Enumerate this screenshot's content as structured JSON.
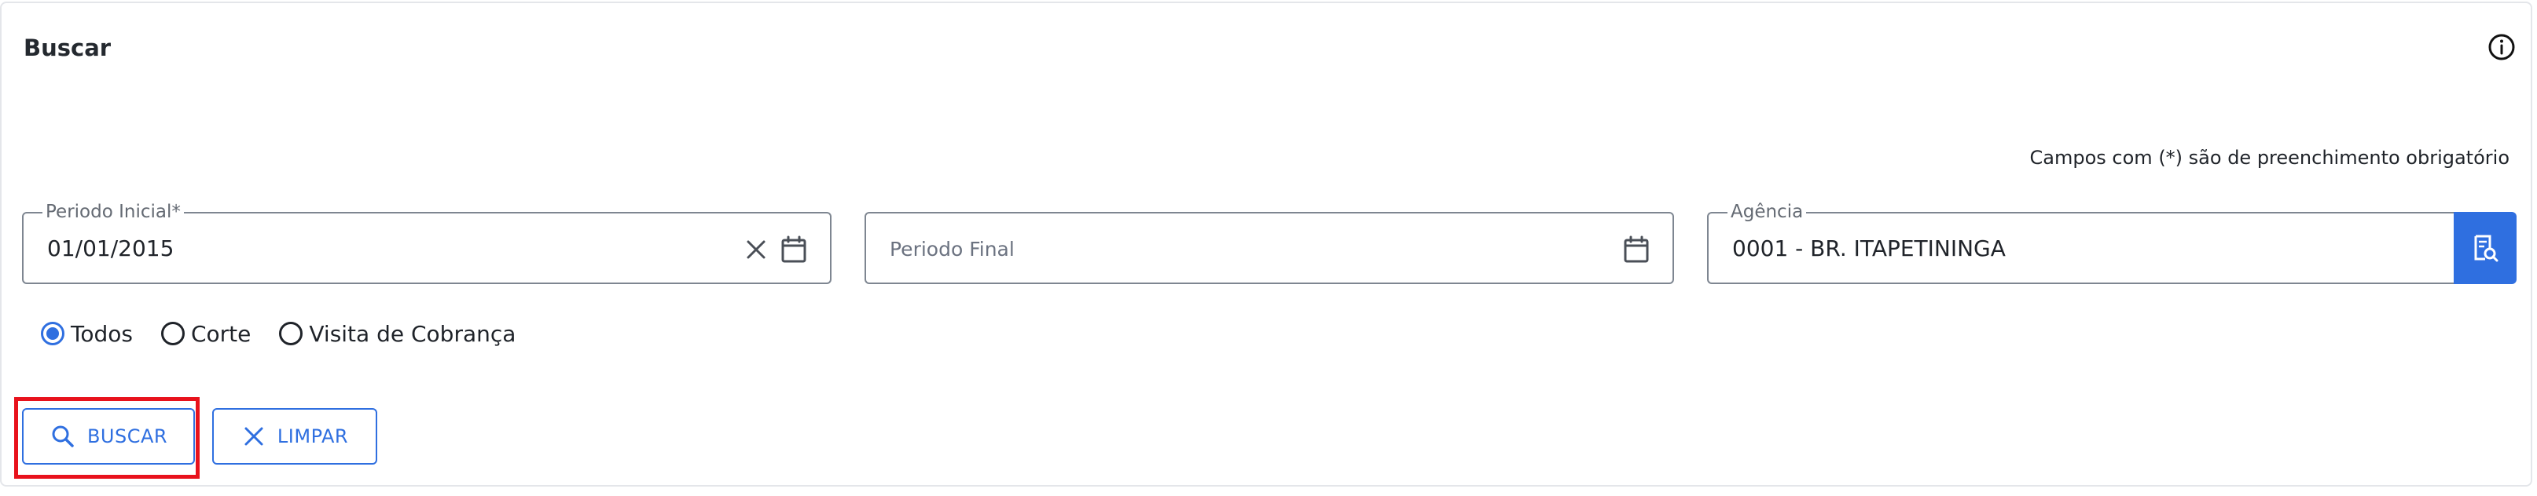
{
  "panel": {
    "title": "Buscar",
    "info_icon": "info-circle-icon",
    "required_note": "Campos com (*) são de preenchimento obrigatório"
  },
  "fields": {
    "periodo_inicial": {
      "label": "Periodo Inicial*",
      "value": "01/01/2015",
      "icons": [
        "close-icon",
        "calendar-icon"
      ]
    },
    "periodo_final": {
      "placeholder": "Periodo Final",
      "value": "",
      "icons": [
        "calendar-icon"
      ]
    },
    "agencia": {
      "label": "Agência",
      "value": "0001 - BR. ITAPETININGA",
      "button_icon": "document-search-icon"
    }
  },
  "radios": [
    {
      "label": "Todos",
      "checked": true
    },
    {
      "label": "Corte",
      "checked": false
    },
    {
      "label": "Visita de Cobrança",
      "checked": false
    }
  ],
  "buttons": {
    "buscar": "BUSCAR",
    "limpar": "LIMPAR"
  },
  "colors": {
    "accent": "#2f6fe0",
    "highlight": "#e8121c",
    "border": "#7e8691",
    "text": "#1f2329"
  }
}
